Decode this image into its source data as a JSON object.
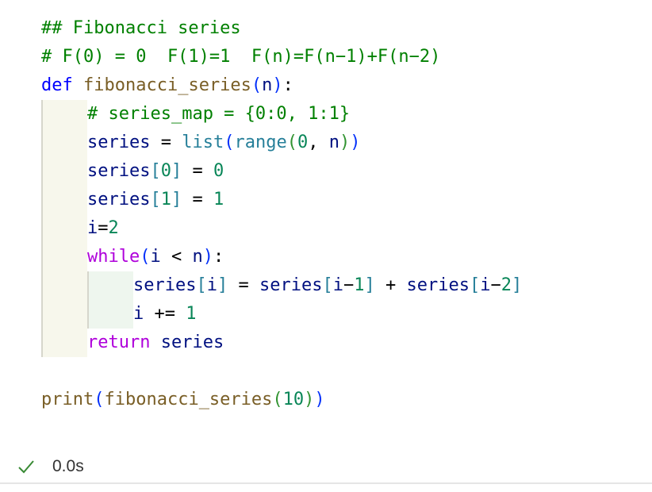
{
  "cell": {
    "lines": [
      {
        "indent": 0,
        "tokens": [
          {
            "t": "## Fibonacci series",
            "c": "comment"
          }
        ]
      },
      {
        "indent": 0,
        "tokens": [
          {
            "t": "# F(0) = 0  F(1)=1  F(n)=F(n−1)+F(n−2)",
            "c": "comment"
          }
        ]
      },
      {
        "indent": 0,
        "tokens": [
          {
            "t": "def",
            "c": "keyword"
          },
          {
            "t": " ",
            "c": "op"
          },
          {
            "t": "fibonacci_series",
            "c": "func"
          },
          {
            "t": "(",
            "c": "paren1"
          },
          {
            "t": "n",
            "c": "var"
          },
          {
            "t": ")",
            "c": "paren1"
          },
          {
            "t": ":",
            "c": "op"
          }
        ]
      },
      {
        "indent": 1,
        "tokens": [
          {
            "t": "# series_map = {0:0, 1:1}",
            "c": "comment"
          }
        ]
      },
      {
        "indent": 1,
        "tokens": [
          {
            "t": "series",
            "c": "var"
          },
          {
            "t": " = ",
            "c": "op"
          },
          {
            "t": "list",
            "c": "builtin"
          },
          {
            "t": "(",
            "c": "paren1"
          },
          {
            "t": "range",
            "c": "builtin"
          },
          {
            "t": "(",
            "c": "paren2"
          },
          {
            "t": "0",
            "c": "num"
          },
          {
            "t": ", ",
            "c": "op"
          },
          {
            "t": "n",
            "c": "var"
          },
          {
            "t": ")",
            "c": "paren2"
          },
          {
            "t": ")",
            "c": "paren1"
          }
        ]
      },
      {
        "indent": 1,
        "tokens": [
          {
            "t": "series",
            "c": "var"
          },
          {
            "t": "[",
            "c": "builtin"
          },
          {
            "t": "0",
            "c": "num"
          },
          {
            "t": "]",
            "c": "builtin"
          },
          {
            "t": " = ",
            "c": "op"
          },
          {
            "t": "0",
            "c": "num"
          }
        ]
      },
      {
        "indent": 1,
        "tokens": [
          {
            "t": "series",
            "c": "var"
          },
          {
            "t": "[",
            "c": "builtin"
          },
          {
            "t": "1",
            "c": "num"
          },
          {
            "t": "]",
            "c": "builtin"
          },
          {
            "t": " = ",
            "c": "op"
          },
          {
            "t": "1",
            "c": "num"
          }
        ]
      },
      {
        "indent": 1,
        "tokens": [
          {
            "t": "i",
            "c": "var"
          },
          {
            "t": "=",
            "c": "op"
          },
          {
            "t": "2",
            "c": "num"
          }
        ]
      },
      {
        "indent": 1,
        "tokens": [
          {
            "t": "while",
            "c": "control"
          },
          {
            "t": "(",
            "c": "paren1"
          },
          {
            "t": "i",
            "c": "var"
          },
          {
            "t": " < ",
            "c": "op"
          },
          {
            "t": "n",
            "c": "var"
          },
          {
            "t": ")",
            "c": "paren1"
          },
          {
            "t": ":",
            "c": "op"
          }
        ]
      },
      {
        "indent": 2,
        "tokens": [
          {
            "t": "series",
            "c": "var"
          },
          {
            "t": "[",
            "c": "builtin"
          },
          {
            "t": "i",
            "c": "var"
          },
          {
            "t": "]",
            "c": "builtin"
          },
          {
            "t": " = ",
            "c": "op"
          },
          {
            "t": "series",
            "c": "var"
          },
          {
            "t": "[",
            "c": "builtin"
          },
          {
            "t": "i",
            "c": "var"
          },
          {
            "t": "−",
            "c": "op"
          },
          {
            "t": "1",
            "c": "num"
          },
          {
            "t": "]",
            "c": "builtin"
          },
          {
            "t": " + ",
            "c": "op"
          },
          {
            "t": "series",
            "c": "var"
          },
          {
            "t": "[",
            "c": "builtin"
          },
          {
            "t": "i",
            "c": "var"
          },
          {
            "t": "−",
            "c": "op"
          },
          {
            "t": "2",
            "c": "num"
          },
          {
            "t": "]",
            "c": "builtin"
          }
        ]
      },
      {
        "indent": 2,
        "tokens": [
          {
            "t": "i",
            "c": "var"
          },
          {
            "t": " += ",
            "c": "op"
          },
          {
            "t": "1",
            "c": "num"
          }
        ]
      },
      {
        "indent": 1,
        "tokens": [
          {
            "t": "return",
            "c": "control"
          },
          {
            "t": " ",
            "c": "op"
          },
          {
            "t": "series",
            "c": "var"
          }
        ]
      },
      {
        "indent": 0,
        "tokens": []
      },
      {
        "indent": 0,
        "tokens": [
          {
            "t": "print",
            "c": "func"
          },
          {
            "t": "(",
            "c": "paren1"
          },
          {
            "t": "fibonacci_series",
            "c": "func"
          },
          {
            "t": "(",
            "c": "paren2"
          },
          {
            "t": "10",
            "c": "num"
          },
          {
            "t": ")",
            "c": "paren2"
          },
          {
            "t": ")",
            "c": "paren1"
          }
        ]
      }
    ]
  },
  "status": {
    "icon": "check-icon",
    "duration": "0.0s",
    "check_color": "#388a34"
  }
}
